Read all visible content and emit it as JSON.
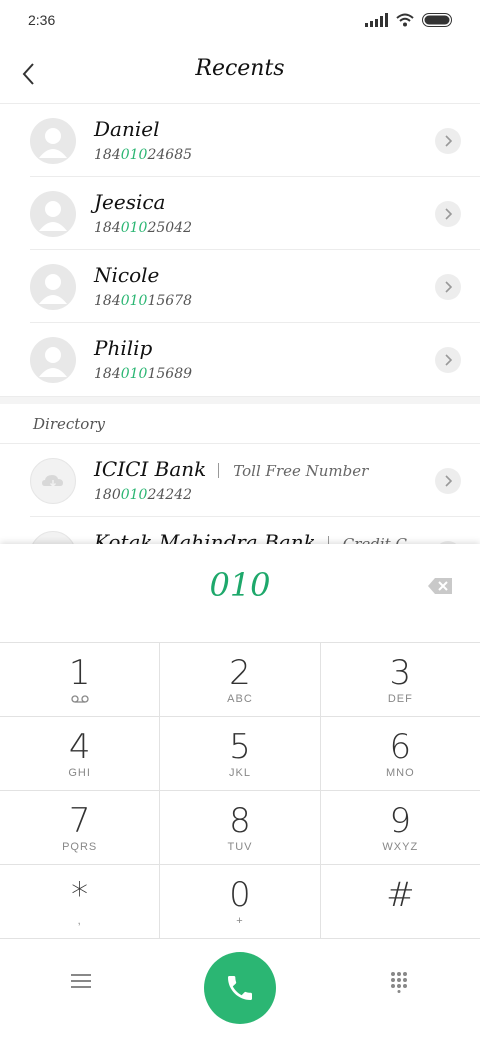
{
  "status_bar": {
    "time": "2:36"
  },
  "header": {
    "title": "Recents"
  },
  "recents": [
    {
      "name": "Daniel",
      "num_pre": "184",
      "num_match": "010",
      "num_post": "24685"
    },
    {
      "name": "Jeesica",
      "num_pre": "184",
      "num_match": "010",
      "num_post": "25042"
    },
    {
      "name": "Nicole",
      "num_pre": "184",
      "num_match": "010",
      "num_post": "15678"
    },
    {
      "name": "Philip",
      "num_pre": "184",
      "num_match": "010",
      "num_post": "15689"
    }
  ],
  "directory": {
    "title": "Directory",
    "items": [
      {
        "name": "ICICI Bank",
        "category": "Toll Free Number",
        "num_pre": "180",
        "num_match": "010",
        "num_post": "24242"
      },
      {
        "name": "Kotak Mahindra Bank",
        "category": "Credit C"
      }
    ]
  },
  "dialer": {
    "digits": "010",
    "keys": [
      {
        "digit": "1",
        "letters": ""
      },
      {
        "digit": "2",
        "letters": "ABC"
      },
      {
        "digit": "3",
        "letters": "DEF"
      },
      {
        "digit": "4",
        "letters": "GHI"
      },
      {
        "digit": "5",
        "letters": "JKL"
      },
      {
        "digit": "6",
        "letters": "MNO"
      },
      {
        "digit": "7",
        "letters": "PQRS"
      },
      {
        "digit": "8",
        "letters": "TUV"
      },
      {
        "digit": "9",
        "letters": "WXYZ"
      },
      {
        "digit": "*",
        "letters": ","
      },
      {
        "digit": "0",
        "letters": "+"
      },
      {
        "digit": "#",
        "letters": ""
      }
    ]
  },
  "colors": {
    "accent": "#2bb673",
    "digits": "#1ea86b"
  },
  "icons": {
    "back": "chevron-left-icon",
    "voicemail": "voicemail-icon",
    "backspace": "backspace-icon",
    "menu": "menu-icon",
    "call": "phone-icon",
    "keypad": "dialpad-icon"
  }
}
